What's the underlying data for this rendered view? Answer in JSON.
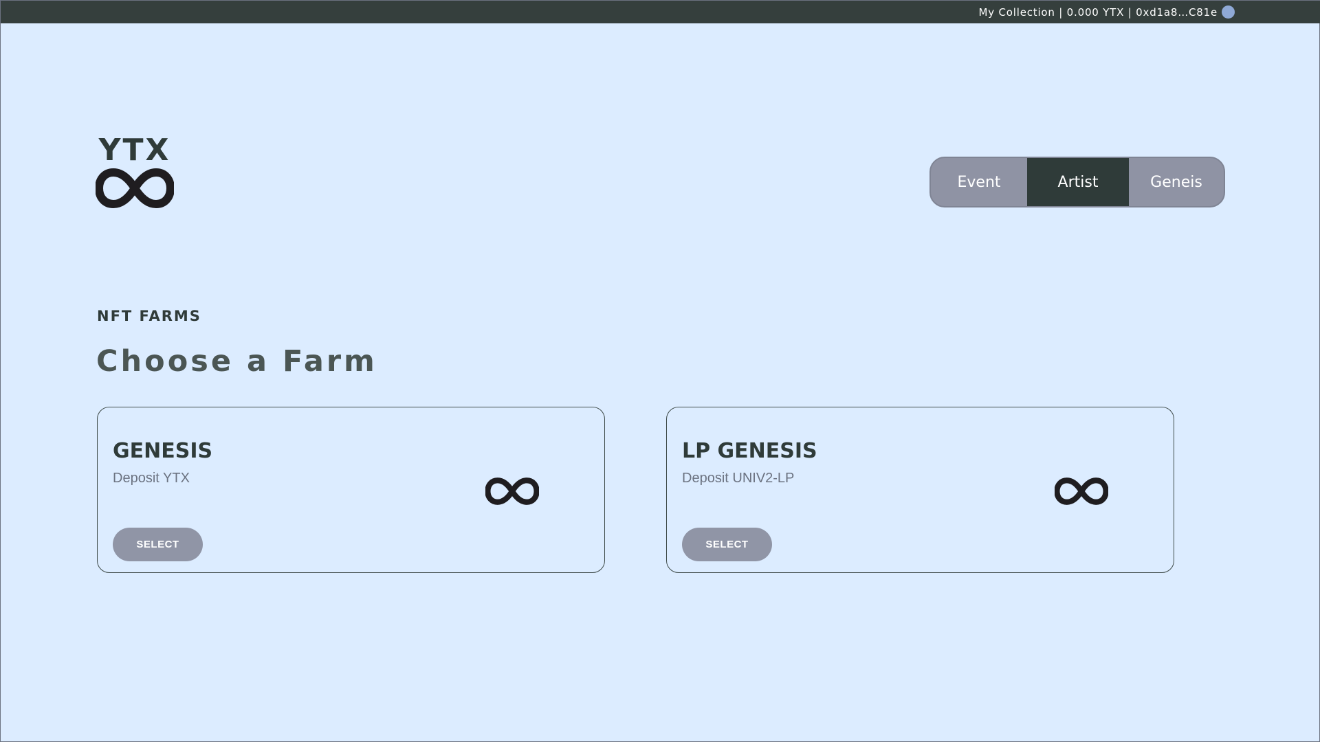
{
  "topbar": {
    "wallet_text": "My Collection | 0.000 YTX  | 0xd1a8…C81e",
    "avatar_icon": "wallet-avatar-icon"
  },
  "logo": {
    "text": "YTX",
    "icon": "infinity-icon"
  },
  "nav": {
    "tabs": [
      {
        "label": "Event",
        "active": false
      },
      {
        "label": "Artist",
        "active": true
      },
      {
        "label": "Geneis",
        "active": false
      }
    ]
  },
  "section": {
    "eyebrow": "NFT FARMS",
    "heading": "Choose a Farm"
  },
  "farms": [
    {
      "title": "GENESIS",
      "subtitle": "Deposit YTX",
      "button": "SELECT",
      "icon": "infinity-icon"
    },
    {
      "title": "LP GENESIS",
      "subtitle": "Deposit UNIV2-LP",
      "button": "SELECT",
      "icon": "infinity-icon"
    }
  ],
  "colors": {
    "background": "#dcecff",
    "topbar": "#353f3d",
    "active_tab": "#2f3b39",
    "inactive_tab": "#8f93a4",
    "button": "#9095a6",
    "avatar": "#8fa9d6"
  }
}
